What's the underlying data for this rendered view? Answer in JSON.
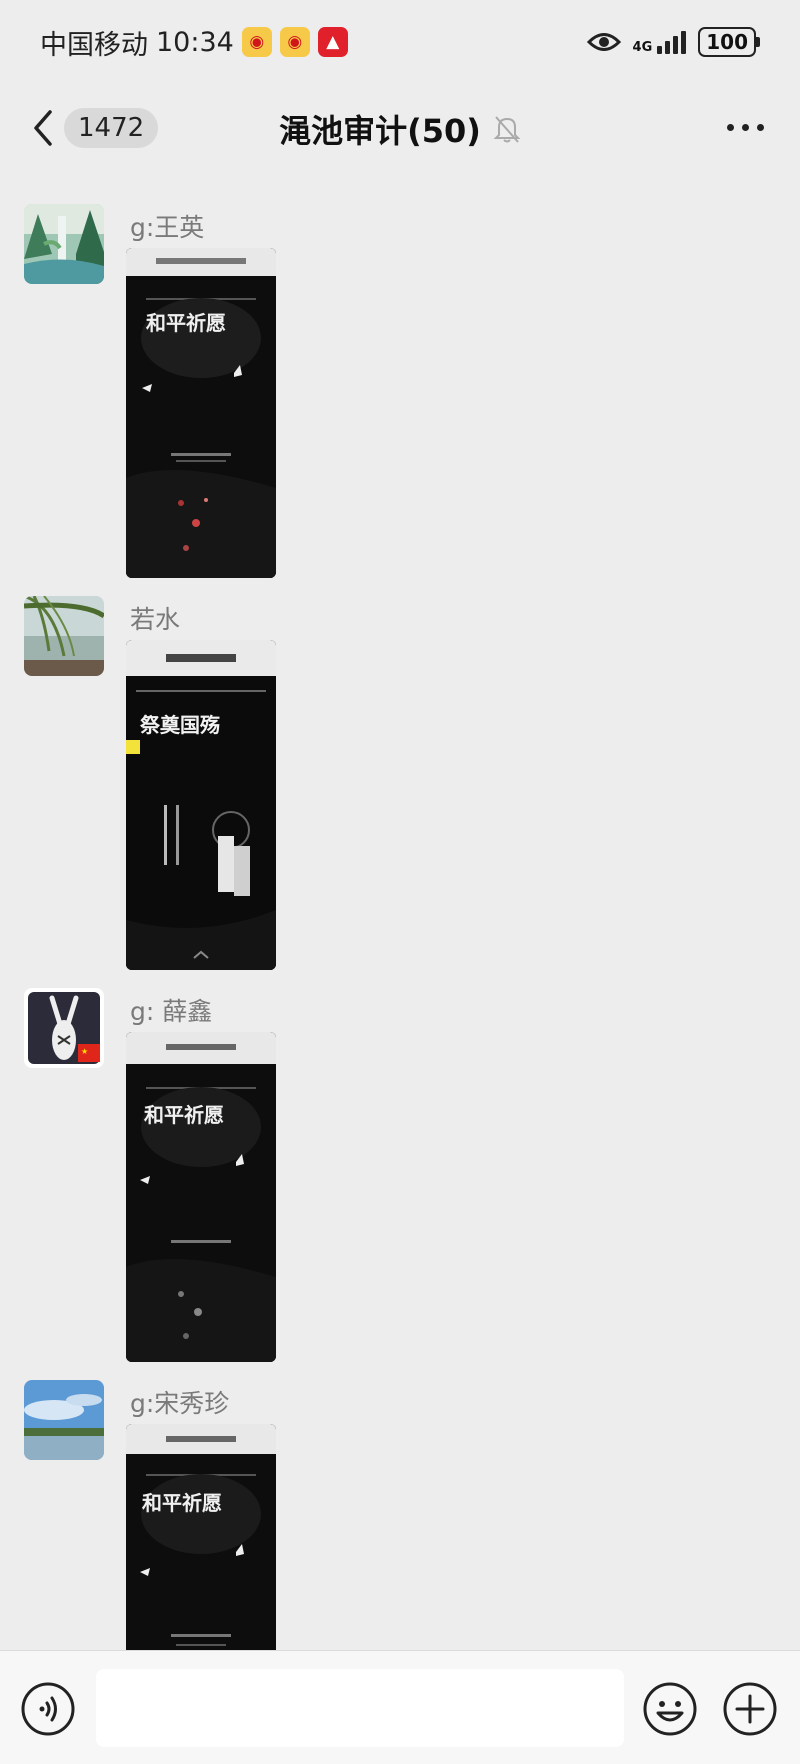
{
  "status_bar": {
    "carrier": "中国移动",
    "time": "10:34",
    "network": "4G",
    "battery": "100",
    "notification_icons": [
      "weibo-icon",
      "weibo-icon",
      "news-icon"
    ]
  },
  "header": {
    "unread_count": "1472",
    "title": "渑池审计(50)",
    "muted": true
  },
  "messages": [
    {
      "sender": "g:王英",
      "avatar": "landscape-waterfall",
      "thumb_title": "和平祈愿"
    },
    {
      "sender": "若水",
      "avatar": "willow-lake",
      "thumb_title": "祭奠国殇"
    },
    {
      "sender": "g:  薛鑫",
      "avatar": "rabbit-illustration",
      "thumb_title": "和平祈愿"
    },
    {
      "sender": "g:宋秀珍",
      "avatar": "blue-sky-lake",
      "thumb_title": "和平祈愿"
    }
  ],
  "input": {
    "placeholder": ""
  },
  "colors": {
    "background": "#ededed",
    "input_bar": "#f7f7f7",
    "thumb_bg": "#111111"
  }
}
